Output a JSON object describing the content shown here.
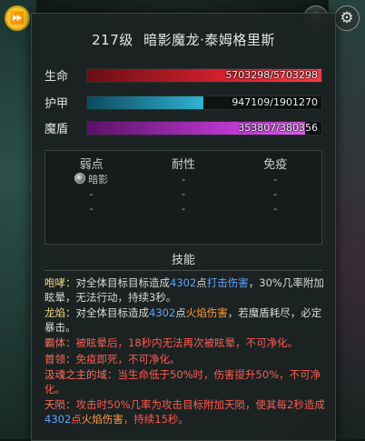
{
  "boss": {
    "level": "217级",
    "name": "暗影魔龙·泰姆格里斯"
  },
  "stats": {
    "hp": {
      "label": "生命",
      "text": "5703298/5703298",
      "fraction": 1.0,
      "color": "#d8212f"
    },
    "armor": {
      "label": "护甲",
      "text": "947109/1901270",
      "fraction": 0.498,
      "color": "#2fb3d4"
    },
    "shield": {
      "label": "魔盾",
      "text": "353807/380356",
      "fraction": 0.93,
      "color": "#c23ad6"
    }
  },
  "resistances": {
    "headers": [
      "弱点",
      "耐性",
      "免疫"
    ],
    "weak": [
      "暗影",
      "-",
      "-"
    ],
    "resist": [
      "-",
      "-",
      "-"
    ],
    "immune": [
      "-",
      "-",
      "-"
    ]
  },
  "skills_title": "技能",
  "skills": [
    {
      "name": "咆哮：",
      "p1": "对全体目标目标造成",
      "num": "4302",
      "p2": "点",
      "dmg": "打击伤害",
      "p3": "，30%几率附加眩晕，无法行动，持续3秒。"
    },
    {
      "name": "龙焰：",
      "p1": "对全体目标造成",
      "num": "4302",
      "p2": "点",
      "dmg": "火焰伤害",
      "p3": "，若魔盾耗尽，必定暴击。"
    },
    {
      "name": "霸体：",
      "text": "被眩晕后，18秒内无法再次被眩晕，不可净化。"
    },
    {
      "name": "首领：",
      "text": "免疫即死，不可净化。"
    },
    {
      "name": "汲魂之主的域：",
      "text": "当生命低于50%时，伤害提升50%，不可净化。"
    },
    {
      "name": "天陨：",
      "p1": "攻击时50%几率为攻击目标附加天陨，使其每2秒造成",
      "num": "4302",
      "p2": "点",
      "dmg": "火焰伤害",
      "p3": "，持续15秒。"
    }
  ],
  "icons": {
    "fast_forward": "fast-forward-icon",
    "user": "user-icon",
    "settings": "gear-icon",
    "shadow": "shadow-element-icon"
  }
}
